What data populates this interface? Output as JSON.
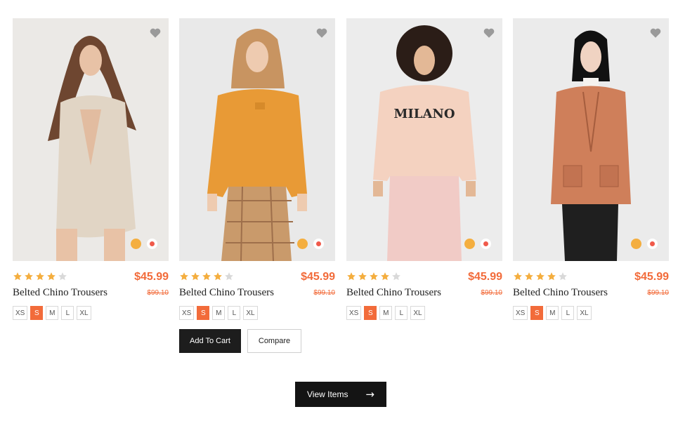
{
  "products": [
    {
      "title": "Belted Chino Trousers",
      "price": "$45.99",
      "old_price": "$99.10",
      "rating": 4,
      "max_rating": 5,
      "sizes": [
        "XS",
        "S",
        "M",
        "L",
        "XL"
      ],
      "selected_size": "S",
      "swatches": [
        "#f4ae3f",
        "#ffffff"
      ],
      "image": "woman in beige blazer dress"
    },
    {
      "title": "Belted Chino Trousers",
      "price": "$45.99",
      "old_price": "$99.10",
      "rating": 4,
      "max_rating": 5,
      "sizes": [
        "XS",
        "S",
        "M",
        "L",
        "XL"
      ],
      "selected_size": "S",
      "swatches": [
        "#f4ae3f",
        "#ffffff"
      ],
      "image": "woman in orange sweatshirt and plaid trousers"
    },
    {
      "title": "Belted Chino Trousers",
      "price": "$45.99",
      "old_price": "$99.10",
      "rating": 4,
      "max_rating": 5,
      "sizes": [
        "XS",
        "S",
        "M",
        "L",
        "XL"
      ],
      "selected_size": "S",
      "swatches": [
        "#f4ae3f",
        "#ffffff"
      ],
      "image": "woman in pink hoodie",
      "print_text": "MILANO"
    },
    {
      "title": "Belted Chino Trousers",
      "price": "$45.99",
      "old_price": "$99.10",
      "rating": 4,
      "max_rating": 5,
      "sizes": [
        "XS",
        "S",
        "M",
        "L",
        "XL"
      ],
      "selected_size": "S",
      "swatches": [
        "#f4ae3f",
        "#ffffff"
      ],
      "image": "woman in rust coat"
    }
  ],
  "actions": {
    "add_to_cart_label": "Add To Cart",
    "compare_label": "Compare"
  },
  "view_items": {
    "label": "View Items",
    "arrow": "→"
  },
  "colors": {
    "accent": "#f26b3a",
    "star_on": "#f4ae3f",
    "star_off": "#d9d9d9",
    "dark_button": "#1d1d1d"
  },
  "icons": {
    "wishlist": "heart-icon",
    "star": "star-icon",
    "view_arrow": "arrow-right-icon"
  }
}
